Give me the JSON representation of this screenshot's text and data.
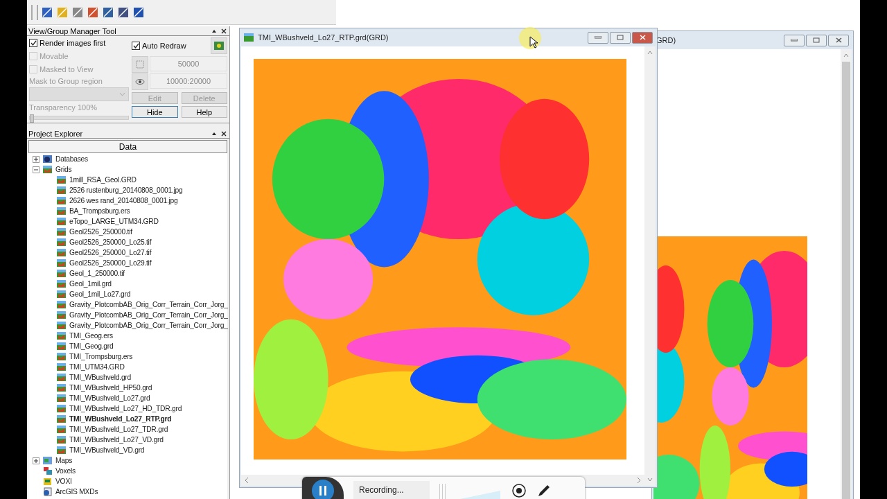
{
  "view_group_tool": {
    "title": "View/Group Manager Tool",
    "checkboxes": [
      {
        "label": "Render images first",
        "checked": true,
        "disabled": false
      },
      {
        "label": "Auto Redraw",
        "checked": true,
        "disabled": false
      },
      {
        "label": "Movable",
        "checked": false,
        "disabled": true
      },
      {
        "label": "Masked to View",
        "checked": false,
        "disabled": true
      }
    ],
    "mask_label": "Mask to Group region",
    "scale": "50000",
    "range": "10000:20000",
    "buttons": [
      {
        "label": "Edit",
        "disabled": true
      },
      {
        "label": "Delete",
        "disabled": true
      },
      {
        "label": "Hide",
        "disabled": false
      },
      {
        "label": "Help",
        "disabled": false
      }
    ],
    "transparency": {
      "label": "Transparency 100%",
      "level": 0
    }
  },
  "project_explorer": {
    "title": "Project Explorer",
    "column": "Data",
    "tree": [
      {
        "label": "Databases",
        "kind": "database",
        "expanded": false
      },
      {
        "label": "Grids",
        "kind": "grid-folder",
        "expanded": true,
        "children": [
          {
            "label": "1mill_RSA_Geol.GRD",
            "selected": false
          },
          {
            "label": "2526 rustenburg_20140808_0001.jpg",
            "selected": false
          },
          {
            "label": "2626 wes rand_20140808_0001.jpg",
            "selected": false
          },
          {
            "label": "BA_Trompsburg.ers",
            "selected": false
          },
          {
            "label": "eTopo_LARGE_UTM34.GRD",
            "selected": false
          },
          {
            "label": "Geol2526_250000.tif",
            "selected": false
          },
          {
            "label": "Geol2526_250000_Lo25.tif",
            "selected": false
          },
          {
            "label": "Geol2526_250000_Lo27.tif",
            "selected": false
          },
          {
            "label": "Geol2526_250000_Lo29.tif",
            "selected": false
          },
          {
            "label": "Geol_1_250000.tif",
            "selected": false
          },
          {
            "label": "Geol_1mil.grd",
            "selected": false
          },
          {
            "label": "Geol_1mil_Lo27.grd",
            "selected": false
          },
          {
            "label": "Gravity_PlotcombAB_Orig_Corr_Terrain_Corr_Jorg_",
            "selected": false
          },
          {
            "label": "Gravity_PlotcombAB_Orig_Corr_Terrain_Corr_Jorg_",
            "selected": false
          },
          {
            "label": "Gravity_PlotcombAB_Orig_Corr_Terrain_Corr_Jorg_",
            "selected": false
          },
          {
            "label": "TMI_Geog.ers",
            "selected": false
          },
          {
            "label": "TMI_Geog.grd",
            "selected": false
          },
          {
            "label": "TMI_Trompsburg.ers",
            "selected": false
          },
          {
            "label": "TMI_UTM34.GRD",
            "selected": false
          },
          {
            "label": "TMI_WBushveld.grd",
            "selected": false
          },
          {
            "label": "TMI_WBushveld_HP50.grd",
            "selected": false
          },
          {
            "label": "TMI_WBushveld_Lo27.grd",
            "selected": false
          },
          {
            "label": "TMI_WBushveld_Lo27_HD_TDR.grd",
            "selected": false
          },
          {
            "label": "TMI_WBushveld_Lo27_RTP.grd",
            "selected": true
          },
          {
            "label": "TMI_WBushveld_Lo27_TDR.grd",
            "selected": false
          },
          {
            "label": "TMI_WBushveld_Lo27_VD.grd",
            "selected": false
          },
          {
            "label": "TMI_WBushveld_VD.grd",
            "selected": false
          }
        ]
      },
      {
        "label": "Maps",
        "kind": "maps",
        "expanded": false
      },
      {
        "label": "Voxels",
        "kind": "voxels"
      },
      {
        "label": "VOXI",
        "kind": "voxi"
      },
      {
        "label": "ArcGIS MXDs",
        "kind": "mxd"
      }
    ]
  },
  "grid_window": {
    "title": "TMI_WBushveld_Lo27_RTP.grd(GRD)"
  },
  "back_window": {
    "title": "GRD)"
  },
  "recorder": {
    "status": "Recording..."
  }
}
